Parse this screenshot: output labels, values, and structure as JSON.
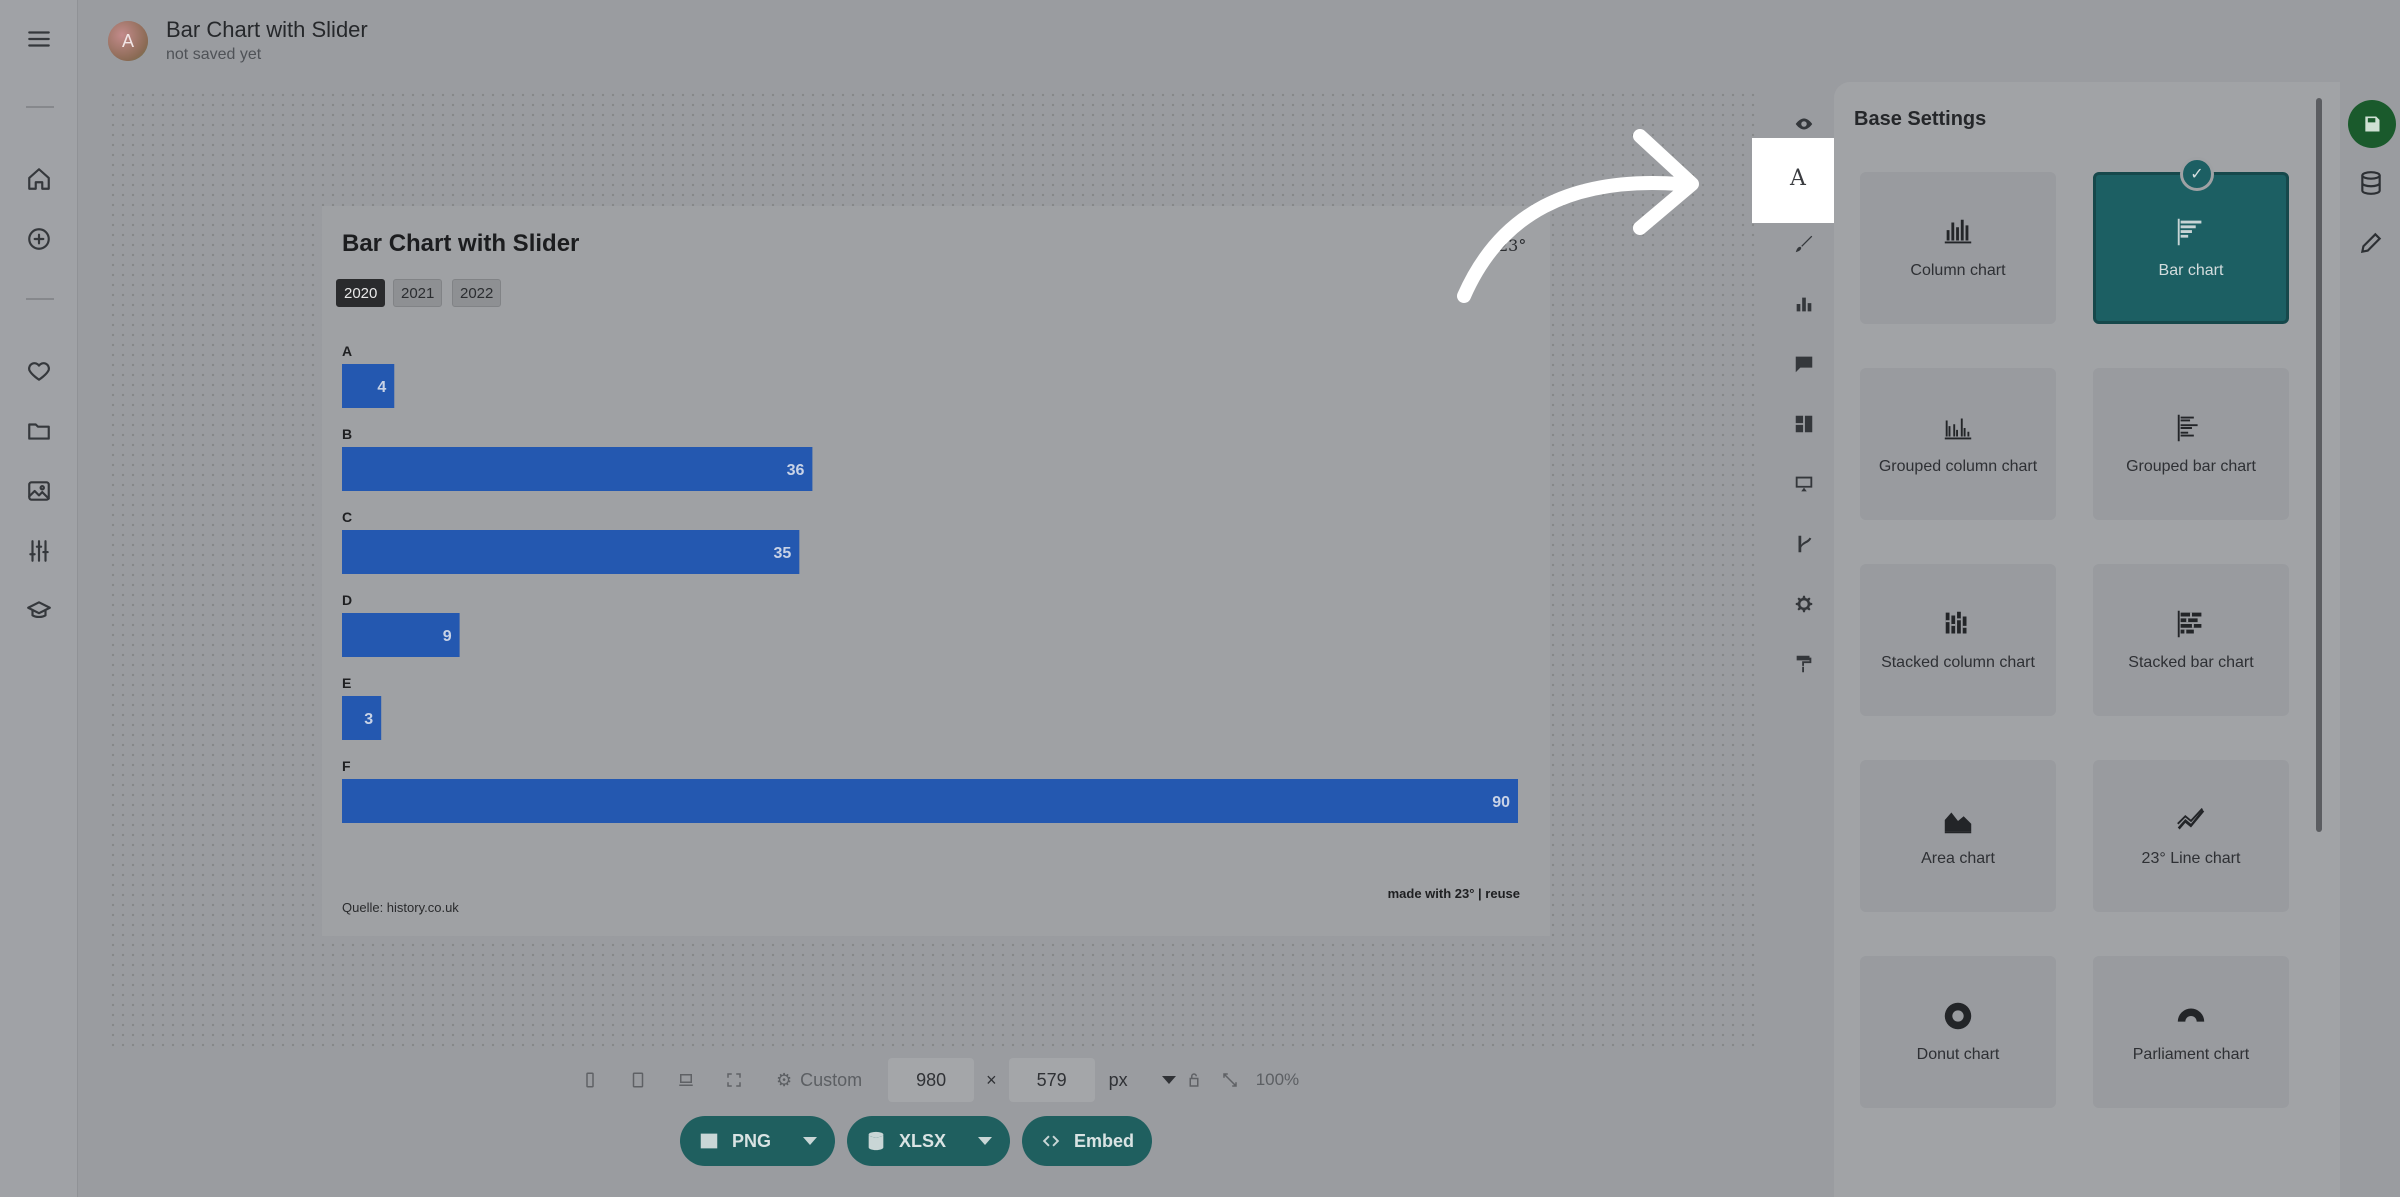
{
  "app": {
    "document_title": "Bar Chart with Slider",
    "document_status": "not saved yet",
    "avatar_letter": "A",
    "user_avatar_letter": "A"
  },
  "left_nav": {
    "items": [
      {
        "icon": "menu-icon"
      },
      {
        "icon": "home-icon"
      },
      {
        "icon": "add-circle-icon"
      },
      {
        "icon": "heart-icon"
      },
      {
        "icon": "folder-icon"
      },
      {
        "icon": "image-icon"
      },
      {
        "icon": "sliders-icon"
      },
      {
        "icon": "graduation-cap-icon"
      }
    ]
  },
  "chart_card": {
    "title": "Bar Chart with Slider",
    "years": [
      "2020",
      "2021",
      "2022"
    ],
    "active_year": "2020",
    "source": "Quelle: history.co.uk",
    "credit": "made with 23° | reuse",
    "logo_text": "23°"
  },
  "chart_data": {
    "type": "bar",
    "orientation": "horizontal",
    "title": "Bar Chart with Slider",
    "categories": [
      "A",
      "B",
      "C",
      "D",
      "E",
      "F"
    ],
    "values": [
      4,
      36,
      35,
      9,
      3,
      90
    ],
    "xlim": [
      0,
      90
    ],
    "bar_color": "#2458b0",
    "data_labels": true,
    "grid": false
  },
  "size_bar": {
    "preset_label": "Custom",
    "width": "980",
    "times": "×",
    "height": "579",
    "unit": "px",
    "zoom": "100%"
  },
  "export": {
    "png_label": "PNG",
    "xlsx_label": "XLSX",
    "embed_label": "Embed"
  },
  "panel": {
    "title": "Base Settings",
    "chart_types": [
      {
        "label": "Column chart",
        "icon": "column-chart-icon",
        "selected": false
      },
      {
        "label": "Bar chart",
        "icon": "bar-chart-icon",
        "selected": true
      },
      {
        "label": "Grouped column chart",
        "icon": "grouped-column-chart-icon",
        "selected": false
      },
      {
        "label": "Grouped bar chart",
        "icon": "grouped-bar-chart-icon",
        "selected": false
      },
      {
        "label": "Stacked column chart",
        "icon": "stacked-column-chart-icon",
        "selected": false
      },
      {
        "label": "Stacked bar chart",
        "icon": "stacked-bar-chart-icon",
        "selected": false
      },
      {
        "label": "Area chart",
        "icon": "area-chart-icon",
        "selected": false
      },
      {
        "label": "23° Line chart",
        "icon": "line-chart-icon",
        "selected": false
      },
      {
        "label": "Donut chart",
        "icon": "donut-chart-icon",
        "selected": false
      },
      {
        "label": "Parliament chart",
        "icon": "parliament-chart-icon",
        "selected": false
      }
    ]
  },
  "tab_rail": {
    "items": [
      "eye-icon",
      "text-icon",
      "brush-icon",
      "bar-chart-icon",
      "comment-icon",
      "layout-icon",
      "presentation-icon",
      "branch-icon",
      "gear-icon",
      "paint-roller-icon"
    ],
    "highlighted_letter": "A"
  },
  "colors": {
    "accent": "#1c5f63",
    "bar": "#2458b0",
    "save": "#1a5a2c"
  }
}
